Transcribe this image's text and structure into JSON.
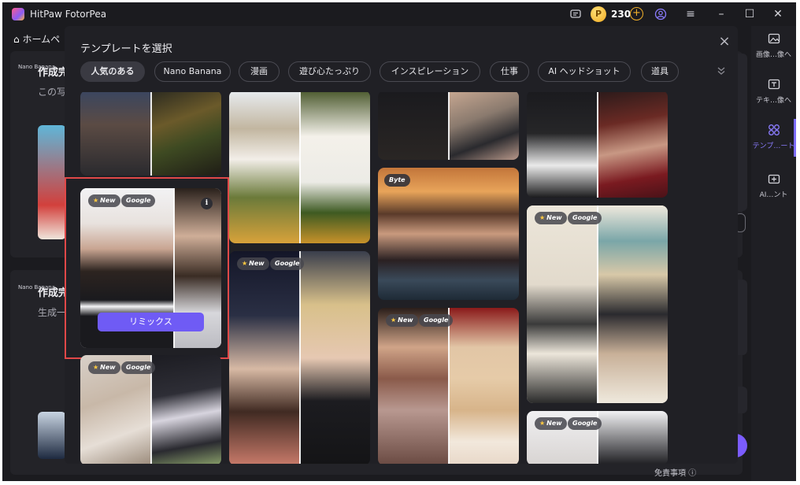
{
  "window": {
    "app_title": "HitPaw FotorPea",
    "coin_count": "230",
    "coin_symbol": "P"
  },
  "background": {
    "home_label": "ホームペ",
    "section1_badge": "Nano Banana",
    "section1_title": "作成完",
    "section1_sub": "この写",
    "section2_badge": "Nano Banana",
    "section2_title": "作成完",
    "section2_sub": "生成一"
  },
  "right_rail": {
    "items": [
      {
        "label": "画像…像へ",
        "icon": "image-edit-icon"
      },
      {
        "label": "テキ…像へ",
        "icon": "text-to-image-icon"
      },
      {
        "label": "テンプ…ート",
        "icon": "template-icon"
      },
      {
        "label": "AI…ント",
        "icon": "ai-add-icon"
      }
    ],
    "active_index": 2
  },
  "disclaimer": "免責事項",
  "modal": {
    "title": "テンプレートを選択",
    "categories": [
      {
        "label": "人気のある",
        "active": true
      },
      {
        "label": "Nano Banana",
        "active": false
      },
      {
        "label": "漫画",
        "active": false
      },
      {
        "label": "遊び心たっぷり",
        "active": false
      },
      {
        "label": "インスピレーション",
        "active": false
      },
      {
        "label": "仕事",
        "active": false
      },
      {
        "label": "AI ヘッドショット",
        "active": false
      },
      {
        "label": "道具",
        "active": false
      }
    ],
    "tags": {
      "new": "New",
      "google": "Google",
      "byte": "Byte"
    },
    "remix_label": "リミックス",
    "info_label": "i"
  },
  "colors": {
    "accent": "#6f5bf5",
    "hover_border": "#e04848",
    "modal_bg": "#202025",
    "app_bg": "#1b1b1f"
  }
}
